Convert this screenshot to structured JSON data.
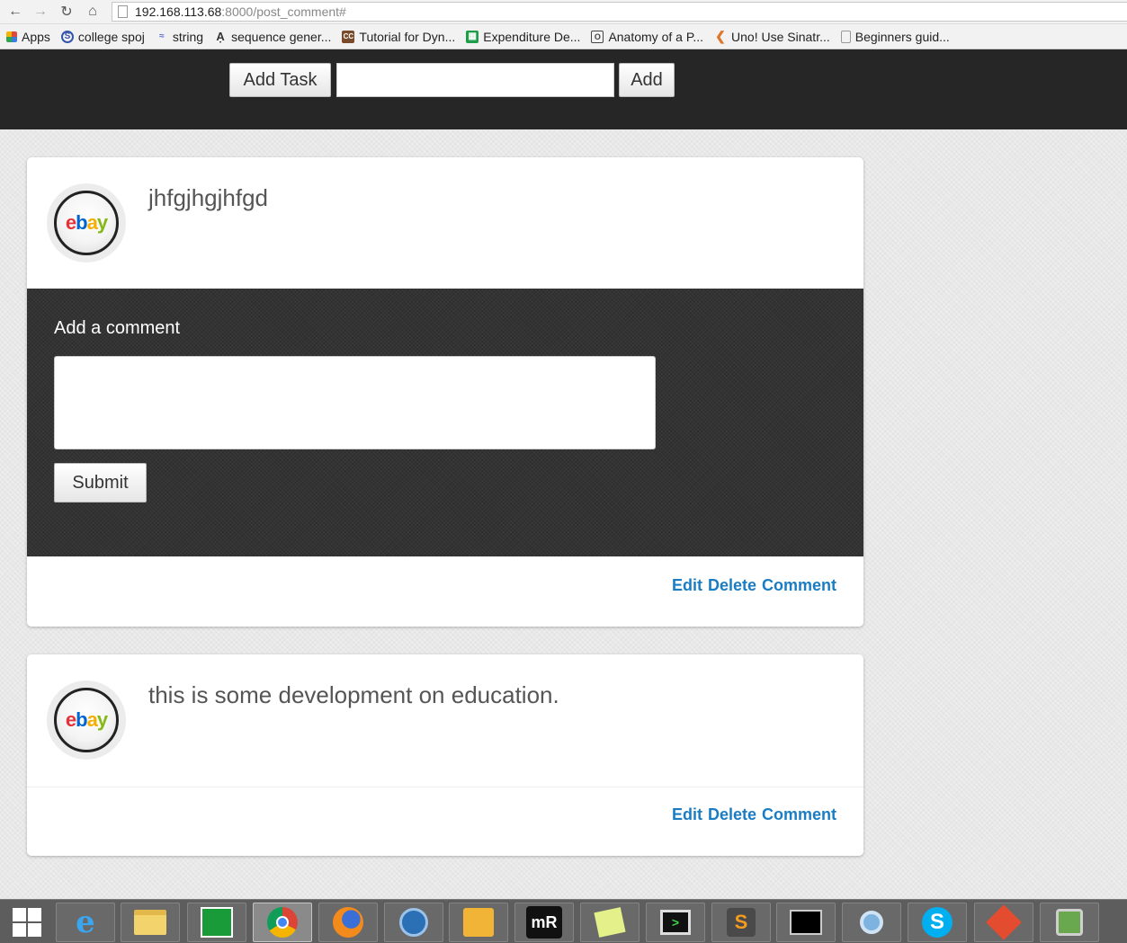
{
  "browser": {
    "url_host": "192.168.113.68",
    "url_rest": ":8000/post_comment#",
    "bookmarks": [
      {
        "label": "Apps",
        "icon": "apps-grid-icon",
        "color": "#e04a3b"
      },
      {
        "label": "college spoj",
        "icon": "spoj-icon",
        "color": "#3355aa"
      },
      {
        "label": "string",
        "icon": "string-icon",
        "color": "#5b6bcf"
      },
      {
        "label": "sequence gener...",
        "icon": "sequence-icon",
        "color": "#444444"
      },
      {
        "label": "Tutorial for Dyn...",
        "icon": "cc-icon",
        "color": "#7a4b2a"
      },
      {
        "label": "Expenditure De...",
        "icon": "sheets-icon",
        "color": "#1e9e4a"
      },
      {
        "label": "Anatomy of a P...",
        "icon": "o-icon",
        "color": "#444444"
      },
      {
        "label": "Uno! Use Sinatr...",
        "icon": "uno-icon",
        "color": "#e0762a"
      },
      {
        "label": "Beginners guid...",
        "icon": "page-icon",
        "color": "#999999"
      }
    ]
  },
  "topbar": {
    "add_task_label": "Add Task",
    "task_input_value": "",
    "add_label": "Add"
  },
  "posts": [
    {
      "text": "jhfgjhgjhfgd",
      "avatar_logo": "ebay",
      "comment_label": "Add a comment",
      "comment_value": "",
      "submit_label": "Submit",
      "edit_label": "Edit",
      "delete_label": "Delete",
      "comment_link_label": "Comment"
    },
    {
      "text": "this is some development on education.",
      "avatar_logo": "ebay",
      "edit_label": "Edit",
      "delete_label": "Delete",
      "comment_link_label": "Comment"
    }
  ],
  "taskbar": {
    "items": [
      "windows-start-icon",
      "internet-explorer-icon",
      "file-explorer-icon",
      "store-icon",
      "chrome-icon",
      "firefox-icon",
      "remote-desktop-icon",
      "outlook-icon",
      "mremoteng-icon",
      "sticky-notes-icon",
      "terminal-icon",
      "sublime-text-icon",
      "cmd-icon",
      "search-tool-icon",
      "skype-icon",
      "git-icon",
      "vpn-icon"
    ]
  },
  "colors": {
    "accent_link": "#1a7dc4",
    "app_bar": "#262626",
    "ebay_e": "#e53238",
    "ebay_b": "#0064d2",
    "ebay_a": "#f5af02",
    "ebay_y": "#86b817"
  }
}
